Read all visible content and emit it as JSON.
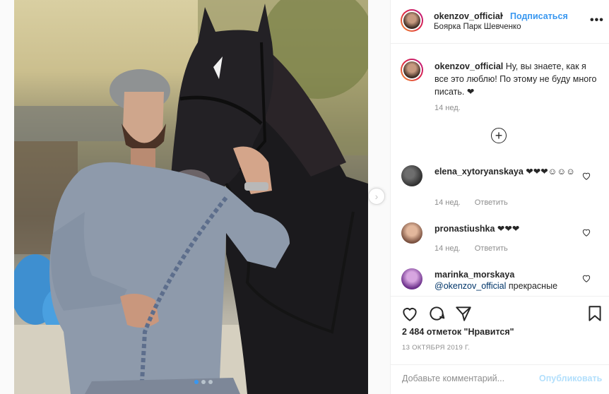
{
  "post": {
    "carousel_dots": 3,
    "active_dot": 0
  },
  "header": {
    "username": "okenzov_official",
    "separator": "•",
    "follow_label": "Подписаться",
    "location": "Боярка Парк Шевченко",
    "more_icon": "more-dots-icon",
    "more_label": "•••"
  },
  "caption": {
    "username": "okenzov_official",
    "text": "Ну, вы знаете, как я все это люблю! По этому не буду много писать. ❤",
    "time": "14 нед."
  },
  "load_more_label": "+",
  "comments": [
    {
      "username": "elena_xytoryanskaya",
      "text": "❤❤❤☺☺☺",
      "time": "14 нед.",
      "reply": "Ответить"
    },
    {
      "username": "pronastiushka",
      "text": "❤❤❤",
      "time": "14 нед.",
      "reply": "Ответить"
    },
    {
      "username": "marinka_morskaya",
      "mention": "@okenzov_official",
      "text": "прекрасные"
    }
  ],
  "actions": {
    "likes": "2 484 отметок \"Нравится\"",
    "date": "13 ОКТЯБРЯ 2019 Г.",
    "comment_placeholder": "Добавьте комментарий...",
    "publish_label": "Опубликовать"
  },
  "colors": {
    "link_blue": "#3897f0",
    "publish_disabled": "#b2dffc",
    "muted": "#8e8e8e"
  }
}
